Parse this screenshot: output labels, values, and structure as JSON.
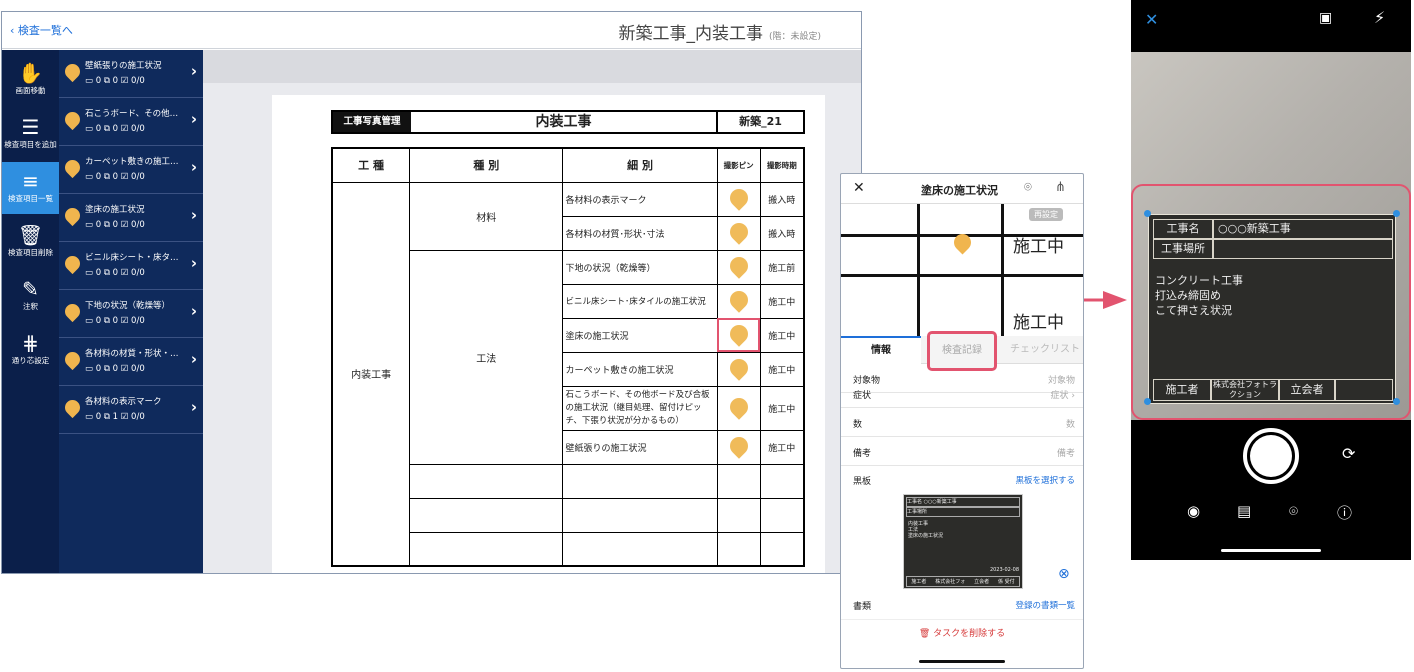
{
  "tablet": {
    "back_label": "検査一覧へ",
    "project_title": "新築工事_内装工事",
    "floor_note": "(階：未設定)",
    "rail": [
      {
        "icon": "hand-icon",
        "label": "画面移動"
      },
      {
        "icon": "list-add-icon",
        "label": "検査項目を追加"
      },
      {
        "icon": "list-pin-icon",
        "label": "検査項目一覧"
      },
      {
        "icon": "trash-icon",
        "label": "検査項目削除"
      },
      {
        "icon": "pencil-icon",
        "label": "注釈"
      },
      {
        "icon": "grid-icon",
        "label": "通り芯設定"
      }
    ],
    "items": [
      {
        "title": "壁紙張りの施工状況",
        "counts": "0 ⧉ 0 ☑ 0/0"
      },
      {
        "title": "石こうボード、その他ボ…",
        "counts": "0 ⧉ 0 ☑ 0/0"
      },
      {
        "title": "カーペット敷きの施工状況",
        "counts": "0 ⧉ 0 ☑ 0/0"
      },
      {
        "title": "塗床の施工状況",
        "counts": "0 ⧉ 0 ☑ 0/0"
      },
      {
        "title": "ビニル床シート・床タイ…",
        "counts": "0 ⧉ 0 ☑ 0/0"
      },
      {
        "title": "下地の状況（乾燥等）",
        "counts": "0 ⧉ 0 ☑ 0/0"
      },
      {
        "title": "各材料の材質・形状・寸法",
        "counts": "0 ⧉ 0 ☑ 0/0"
      },
      {
        "title": "各材料の表示マーク",
        "counts": "0 ⧉ 1 ☑ 0/0"
      }
    ],
    "form": {
      "label": "工事写真管理",
      "title": "内装工事",
      "code": "新築_21",
      "headers": [
        "工 種",
        "種 別",
        "細 別",
        "撮影ピン",
        "撮影時期"
      ],
      "koshu": "内装工事",
      "zairyo": "材料",
      "koho": "工法",
      "rows": [
        {
          "d": "各材料の表示マーク",
          "t": "搬入時"
        },
        {
          "d": "各材料の材質･形状･寸法",
          "t": "搬入時"
        },
        {
          "d": "下地の状況（乾燥等）",
          "t": "施工前"
        },
        {
          "d": "ビニル床シート･床タイルの施工状況",
          "t": "施工中"
        },
        {
          "d": "塗床の施工状況",
          "t": "施工中"
        },
        {
          "d": "カーペット敷きの施工状況",
          "t": "施工中"
        },
        {
          "d": "石こうボード、その他ボード及び合板の施工状況（継目処理、留付けピッチ、下張り状況が分かるもの）",
          "t": "施工中"
        },
        {
          "d": "壁紙張りの施工状況",
          "t": "施工中"
        }
      ]
    }
  },
  "phone2": {
    "title": "塗床の施工状況",
    "map_badge": "再設定",
    "map_text_1": "施工中",
    "map_text_2": "施工中",
    "tabs": [
      "情報",
      "検査記録",
      "チェックリスト"
    ],
    "fields": [
      {
        "k": "対象物",
        "v": "対象物"
      },
      {
        "k": "症状",
        "v": "症状 ›"
      },
      {
        "k": "数",
        "v": "数"
      },
      {
        "k": "備考",
        "v": "備考"
      }
    ],
    "blackboard_label": "黒板",
    "blackboard_link": "黒板を選択する",
    "mini_board": {
      "r1k": "工事名",
      "r1v": "○○○新築工事",
      "r2k": "工事場所",
      "body": "内装工事\n工法\n塗床の施工状況",
      "date": "2023-02-08",
      "f1": "施工者",
      "f2": "株式会社フォトラクション",
      "f3": "立会者",
      "f4": "係 受付"
    },
    "docs_label": "書類",
    "docs_link": "登録の書類一覧",
    "delete_label": "タスクを削除する"
  },
  "phone3": {
    "board": {
      "k1": "工事名",
      "v1": "○○○新築工事",
      "k2": "工事場所",
      "body": "コンクリート工事\n打込み締固め\nこて押さえ状況",
      "f1": "施工者",
      "f2": "株式会社フォトラクション",
      "f3": "立会者"
    }
  },
  "colors": {
    "accent": "#e2546f",
    "nav": "#0b1f4a",
    "pin": "#f0b54e",
    "link": "#1e6fd9"
  }
}
